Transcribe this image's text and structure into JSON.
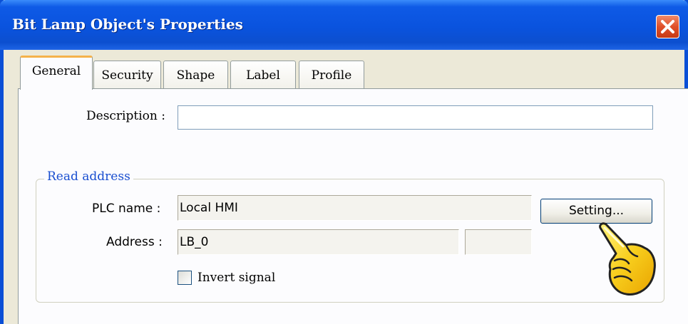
{
  "window": {
    "title": "Bit Lamp Object's Properties",
    "close_icon": "close-icon"
  },
  "tabs": [
    {
      "label": "General",
      "active": true
    },
    {
      "label": "Security",
      "active": false
    },
    {
      "label": "Shape",
      "active": false
    },
    {
      "label": "Label",
      "active": false
    },
    {
      "label": "Profile",
      "active": false
    }
  ],
  "general": {
    "description_label": "Description :",
    "description_value": "",
    "read_address": {
      "title": "Read address",
      "plc_name_label": "PLC name :",
      "plc_name_value": "Local HMI",
      "setting_button": "Setting...",
      "address_label": "Address :",
      "address_value": "LB_0",
      "address_extra_value": "",
      "invert_signal_label": "Invert signal",
      "invert_signal_checked": false
    }
  },
  "annotation": {
    "pointer_icon": "pointing-hand-icon"
  },
  "colors": {
    "titlebar": "#0a53de",
    "group_title": "#1a4fd0",
    "active_tab_accent": "#f5b24a",
    "close_button": "#e0502a"
  }
}
